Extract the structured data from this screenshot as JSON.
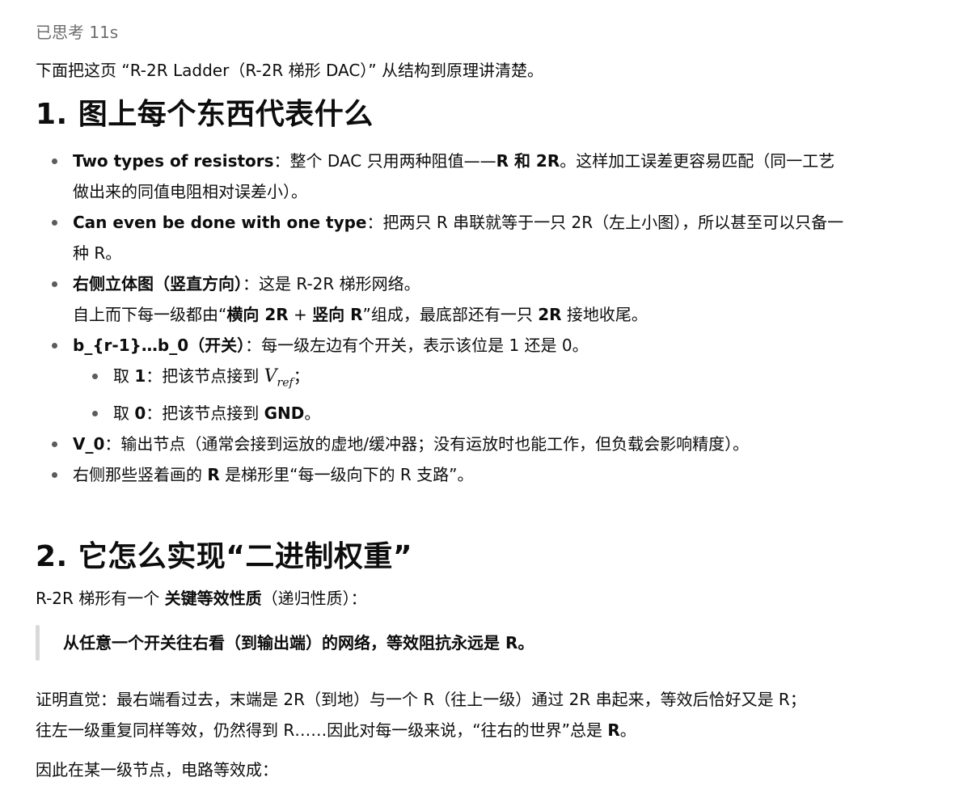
{
  "thought_label": "已思考 11s",
  "intro": "下面把这页 “R-2R Ladder（R-2R 梯形 DAC）” 从结构到原理讲清楚。",
  "section1": {
    "heading": "1. 图上每个东西代表什么",
    "b1": {
      "term": "Two types of resistors",
      "t1": "：整个 DAC 只用两种阻值——",
      "bold": "R 和 2R",
      "t2": "。这样加工误差更容易匹配（同一工艺",
      "line2": "做出来的同值电阻相对误差小）。"
    },
    "b2": {
      "term": "Can even be done with one type",
      "t1": "：把两只 R 串联就等于一只 2R（左上小图），所以甚至可以只备一",
      "line2": "种 R。"
    },
    "b3": {
      "term": "右侧立体图（竖直方向）",
      "t1": "：这是 R-2R 梯形网络。",
      "l2a": "自上而下每一级都由“",
      "l2b": "横向 2R",
      "l2c": " + ",
      "l2d": "竖向 R",
      "l2e": "”组成，最底部还有一只 ",
      "l2f": "2R",
      "l2g": " 接地收尾。"
    },
    "b4": {
      "term": "b_{r-1}…b_0（开关）",
      "t1": "：每一级左边有个开关，表示该位是 1 还是 0。",
      "sub1_a": "取 ",
      "sub1_b": "1",
      "sub1_c": "：把该节点接到 ",
      "sub1_math": "V",
      "sub1_sub": "ref",
      "sub1_d": "；",
      "sub2_a": "取 ",
      "sub2_b": "0",
      "sub2_c": "：把该节点接到 ",
      "sub2_d": "GND",
      "sub2_e": "。"
    },
    "b5": {
      "term": "V_0",
      "t1": "：输出节点（通常会接到运放的虚地/缓冲器；没有运放时也能工作，但负载会影响精度）。"
    },
    "b6": {
      "t1": "右侧那些竖着画的 ",
      "bold": "R",
      "t2": " 是梯形里“每一级向下的 R 支路”。"
    }
  },
  "section2": {
    "heading": "2. 它怎么实现“二进制权重”",
    "p1_a": "R-2R 梯形有一个 ",
    "p1_b": "关键等效性质",
    "p1_c": "（递归性质）：",
    "quote": "从任意一个开关往右看（到输出端）的网络，等效阻抗永远是 R。",
    "proof_line1": "证明直觉：最右端看过去，末端是 2R（到地）与一个 R（往上一级）通过 2R 串起来，等效后恰好又是 R；",
    "proof_line2a": "往左一级重复同样等效，仍然得到 R……因此对每一级来说，“往右的世界”总是 ",
    "proof_line2b": "R",
    "proof_line2c": "。",
    "last": "因此在某一级节点，电路等效成："
  }
}
